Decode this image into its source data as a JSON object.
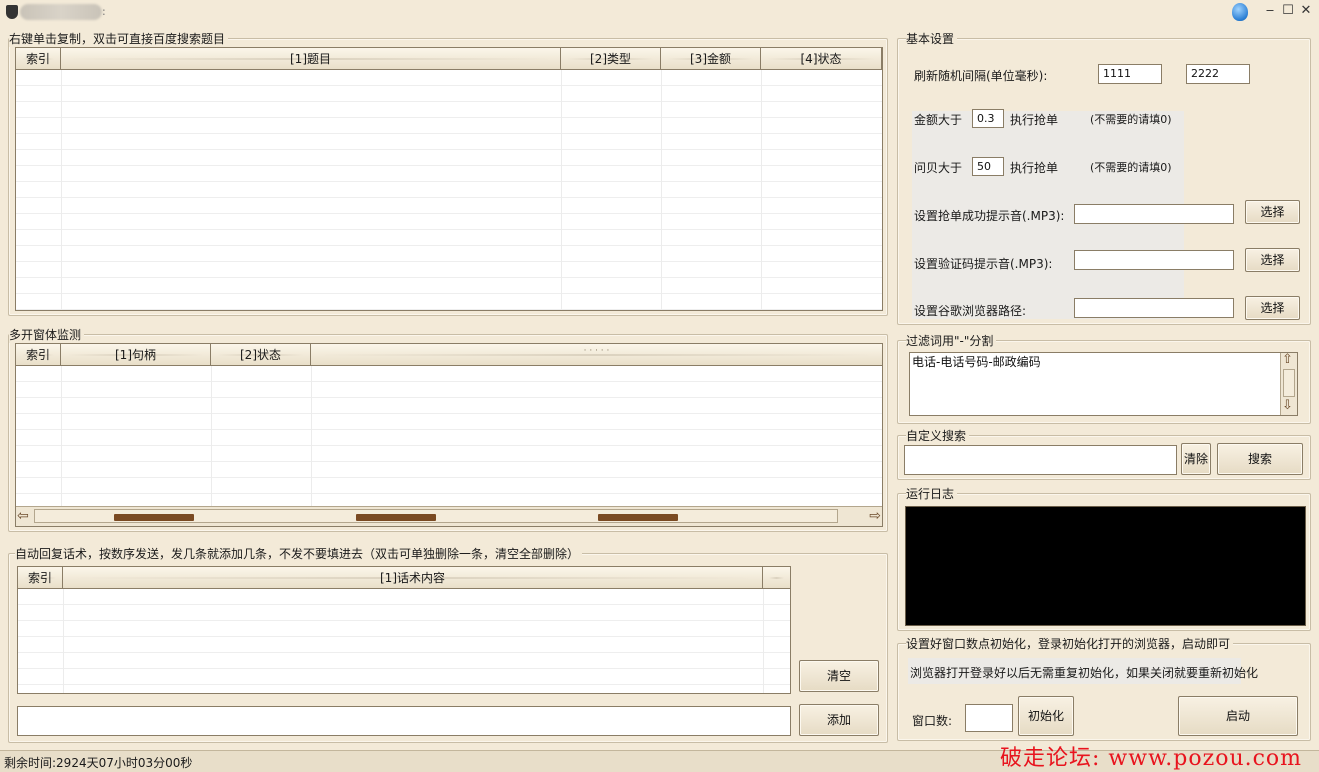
{
  "window": {
    "title_suffix": ":",
    "minimize": "‒",
    "maximize": "☐",
    "close": "✕"
  },
  "questions": {
    "title": "右键单击复制，双击可直接百度搜索题目",
    "columns": [
      "索引",
      "[1]题目",
      "[2]类型",
      "[3]金额",
      "[4]状态"
    ]
  },
  "multi": {
    "title": "多开窗体监测",
    "columns": [
      "索引",
      "[1]句柄",
      "[2]状态"
    ],
    "dots": "· · · · ·"
  },
  "autoreply": {
    "title": "自动回复话术，按数序发送，发几条就添加几条，不发不要填进去（双击可单独删除一条，清空全部删除）",
    "columns": [
      "索引",
      "[1]话术内容"
    ],
    "clear_button": "清空",
    "add_button": "添加",
    "input_value": ""
  },
  "settings": {
    "title": "基本设置",
    "refresh_label": "刷新随机间隔(单位毫秒):",
    "refresh_min": "1111",
    "refresh_max": "2222",
    "amount_label": "金额大于",
    "amount_value": "0.3",
    "amount_action": "执行抢单",
    "amount_hint": "(不需要的请填0)",
    "wenbei_label": "问贝大于",
    "wenbei_value": "50",
    "wenbei_action": "执行抢单",
    "wenbei_hint": "(不需要的请填0)",
    "success_sound_label": "设置抢单成功提示音(.MP3):",
    "captcha_sound_label": "设置验证码提示音(.MP3):",
    "chrome_path_label": "设置谷歌浏览器路径:",
    "choose_button": "选择"
  },
  "filter": {
    "title": "过滤词用\"-\"分割",
    "content": "电话-电话号码-邮政编码"
  },
  "search": {
    "title": "自定义搜索",
    "clear_button": "清除",
    "search_button": "搜索",
    "input_value": ""
  },
  "log": {
    "title": "运行日志"
  },
  "init": {
    "title": "设置好窗口数点初始化，登录初始化打开的浏览器，启动即可",
    "note": "浏览器打开登录好以后无需重复初始化，如果关闭就要重新初始化",
    "window_count_label": "窗口数:",
    "window_count_value": "",
    "init_button": "初始化",
    "start_button": "启动"
  },
  "status": {
    "remaining": "剩余时间:2924天07小时03分00秒"
  },
  "watermark": "破走论坛: www.pozou.com",
  "colors": {
    "background": "#f3ead8",
    "border": "#8a7d66",
    "scroll_thumb": "#7a4a22",
    "watermark": "#e8141e"
  }
}
